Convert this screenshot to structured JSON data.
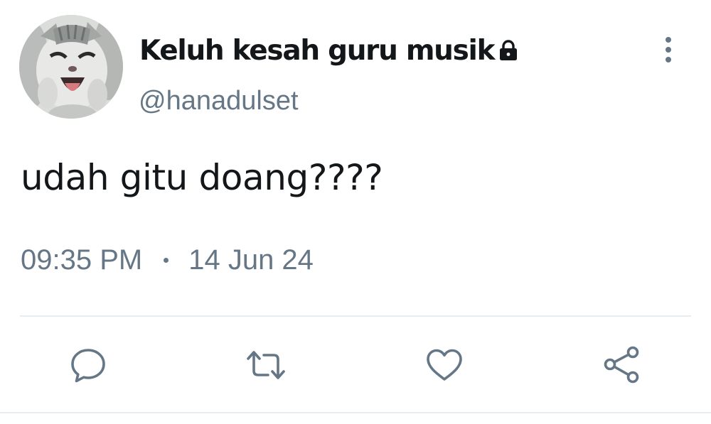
{
  "tweet": {
    "author": {
      "display_name": "Keluh kesah guru musik",
      "handle": "@hanadulset",
      "protected": true,
      "avatar": "cat-photo"
    },
    "text": "udah gitu doang????",
    "time": "09:35 PM",
    "date": "14 Jun 24"
  },
  "actions": [
    {
      "name": "reply",
      "icon": "speech-bubble-icon"
    },
    {
      "name": "retweet",
      "icon": "retweet-icon"
    },
    {
      "name": "like",
      "icon": "heart-icon"
    },
    {
      "name": "share",
      "icon": "share-icon"
    }
  ],
  "colors": {
    "text_primary": "#14171a",
    "text_secondary": "#657786",
    "divider": "#e6ecf0"
  }
}
